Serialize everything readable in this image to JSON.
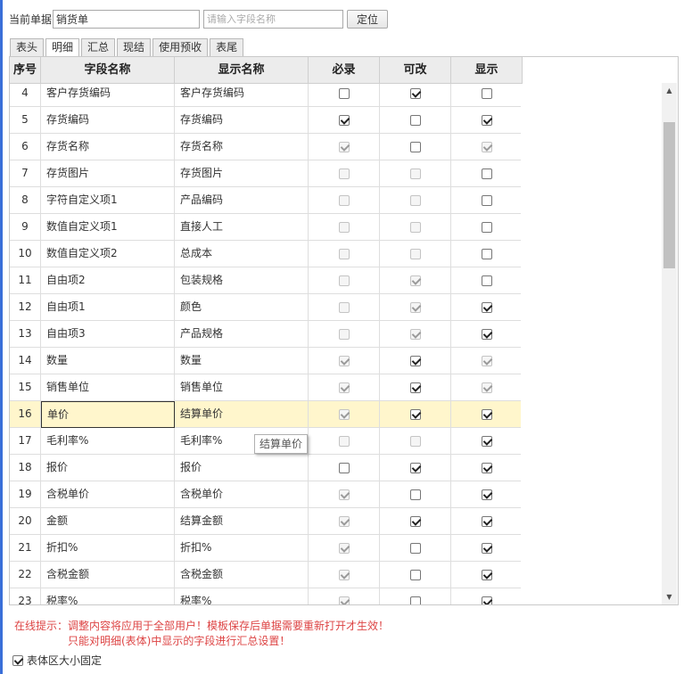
{
  "toolbar": {
    "current_doc_label": "当前单据",
    "current_doc_value": "销货单",
    "search_placeholder": "请输入字段名称",
    "locate_button": "定位"
  },
  "tabs": [
    {
      "label": "表头",
      "active": false
    },
    {
      "label": "明细",
      "active": true
    },
    {
      "label": "汇总",
      "active": false
    },
    {
      "label": "现结",
      "active": false
    },
    {
      "label": "使用预收",
      "active": false
    },
    {
      "label": "表尾",
      "active": false
    }
  ],
  "columns": {
    "seq": "序号",
    "field": "字段名称",
    "display": "显示名称",
    "required": "必录",
    "editable": "可改",
    "visible": "显示"
  },
  "rows": [
    {
      "seq": "4",
      "field": "客户存货编码",
      "display": "客户存货编码",
      "required": [
        false,
        false
      ],
      "editable": [
        true,
        false
      ],
      "visible": [
        false,
        false
      ]
    },
    {
      "seq": "5",
      "field": "存货编码",
      "display": "存货编码",
      "required": [
        true,
        false
      ],
      "editable": [
        false,
        false
      ],
      "visible": [
        true,
        false
      ]
    },
    {
      "seq": "6",
      "field": "存货名称",
      "display": "存货名称",
      "required": [
        true,
        true
      ],
      "editable": [
        false,
        false
      ],
      "visible": [
        true,
        true
      ]
    },
    {
      "seq": "7",
      "field": "存货图片",
      "display": "存货图片",
      "required": [
        false,
        true
      ],
      "editable": [
        false,
        true
      ],
      "visible": [
        false,
        false
      ]
    },
    {
      "seq": "8",
      "field": "字符自定义项1",
      "display": "产品编码",
      "required": [
        false,
        true
      ],
      "editable": [
        false,
        true
      ],
      "visible": [
        false,
        false
      ]
    },
    {
      "seq": "9",
      "field": "数值自定义项1",
      "display": "直接人工",
      "required": [
        false,
        true
      ],
      "editable": [
        false,
        true
      ],
      "visible": [
        false,
        false
      ]
    },
    {
      "seq": "10",
      "field": "数值自定义项2",
      "display": "总成本",
      "required": [
        false,
        true
      ],
      "editable": [
        false,
        true
      ],
      "visible": [
        false,
        false
      ]
    },
    {
      "seq": "11",
      "field": "自由项2",
      "display": "包装规格",
      "required": [
        false,
        true
      ],
      "editable": [
        true,
        true
      ],
      "visible": [
        false,
        false
      ]
    },
    {
      "seq": "12",
      "field": "自由项1",
      "display": "颜色",
      "required": [
        false,
        true
      ],
      "editable": [
        true,
        true
      ],
      "visible": [
        true,
        false
      ]
    },
    {
      "seq": "13",
      "field": "自由项3",
      "display": "产品规格",
      "required": [
        false,
        true
      ],
      "editable": [
        true,
        true
      ],
      "visible": [
        true,
        false
      ]
    },
    {
      "seq": "14",
      "field": "数量",
      "display": "数量",
      "required": [
        true,
        true
      ],
      "editable": [
        true,
        false
      ],
      "visible": [
        true,
        true
      ]
    },
    {
      "seq": "15",
      "field": "销售单位",
      "display": "销售单位",
      "required": [
        true,
        true
      ],
      "editable": [
        true,
        false
      ],
      "visible": [
        true,
        true
      ]
    },
    {
      "seq": "16",
      "field": "单价",
      "display": "结算单价",
      "required": [
        true,
        true
      ],
      "editable": [
        true,
        false
      ],
      "visible": [
        true,
        false
      ],
      "selected": true
    },
    {
      "seq": "17",
      "field": "毛利率%",
      "display": "毛利率%",
      "required": [
        false,
        true
      ],
      "editable": [
        false,
        true
      ],
      "visible": [
        true,
        false
      ]
    },
    {
      "seq": "18",
      "field": "报价",
      "display": "报价",
      "required": [
        false,
        false
      ],
      "editable": [
        true,
        false
      ],
      "visible": [
        true,
        false
      ]
    },
    {
      "seq": "19",
      "field": "含税单价",
      "display": "含税单价",
      "required": [
        true,
        true
      ],
      "editable": [
        false,
        false
      ],
      "visible": [
        true,
        false
      ]
    },
    {
      "seq": "20",
      "field": "金额",
      "display": "结算金额",
      "required": [
        true,
        true
      ],
      "editable": [
        true,
        false
      ],
      "visible": [
        true,
        false
      ]
    },
    {
      "seq": "21",
      "field": "折扣%",
      "display": "折扣%",
      "required": [
        true,
        true
      ],
      "editable": [
        false,
        false
      ],
      "visible": [
        true,
        false
      ]
    },
    {
      "seq": "22",
      "field": "含税金额",
      "display": "含税金额",
      "required": [
        true,
        true
      ],
      "editable": [
        false,
        false
      ],
      "visible": [
        true,
        false
      ]
    },
    {
      "seq": "23",
      "field": "税率%",
      "display": "税率%",
      "required": [
        true,
        true
      ],
      "editable": [
        false,
        false
      ],
      "visible": [
        true,
        false
      ]
    }
  ],
  "tooltip": "结算单价",
  "tips": {
    "line1": "在线提示：调整内容将应用于全部用户！模板保存后单据需要重新打开才生效！",
    "line2": "只能对明细(表体)中显示的字段进行汇总设置！"
  },
  "fixed_size": {
    "label": "表体区大小固定",
    "checked": true
  }
}
